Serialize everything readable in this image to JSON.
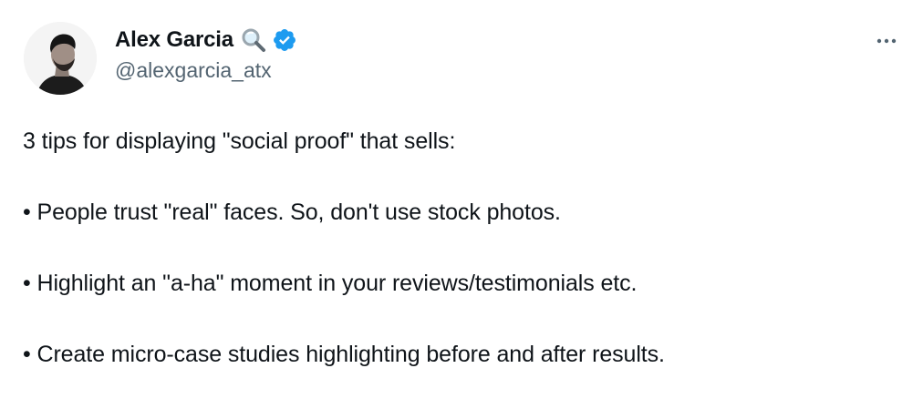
{
  "author": {
    "display_name": "Alex Garcia",
    "handle": "@alexgarcia_atx",
    "name_emoji_icon": "magnifying-glass-icon",
    "verified_icon": "verified-badge-icon",
    "verified_color": "#1d9bf0"
  },
  "menu": {
    "more_icon": "more-horizontal-icon"
  },
  "tweet": {
    "lines": [
      "3 tips for displaying \"social proof\" that sells:",
      "• People trust \"real\" faces. So, don't use stock photos.",
      "• Highlight an \"a-ha\" moment in your reviews/testimonials etc.",
      "• Create micro-case studies highlighting before and after results."
    ]
  },
  "colors": {
    "text_primary": "#0f1419",
    "text_secondary": "#536471"
  }
}
